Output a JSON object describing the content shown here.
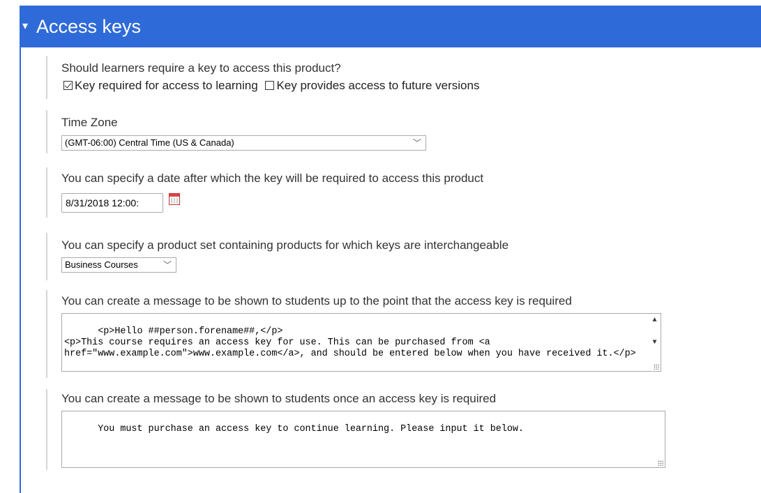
{
  "header": {
    "caret": "▾",
    "title": "Access keys"
  },
  "sections": {
    "require_key": {
      "label": "Should learners require a key to access this product?",
      "options": [
        {
          "label": "Key required for access to learning",
          "checked": true
        },
        {
          "label": "Key provides access to future versions",
          "checked": false
        }
      ]
    },
    "timezone": {
      "label": "Time Zone",
      "selected": "(GMT-06:00) Central Time (US & Canada)"
    },
    "date": {
      "label": "You can specify a date after which the key will be required to access this product",
      "value": "8/31/2018 12:00:"
    },
    "product_set": {
      "label": "You can specify a product set containing products for which keys are interchangeable",
      "selected": "Business Courses"
    },
    "pre_message": {
      "label": "You can create a message to be shown to students up to the point that the access key is required",
      "value": "<p>Hello ##person.forename##,</p>\n<p>This course requires an access key for use. This can be purchased from <a href=\"www.example.com\">www.example.com</a>, and should be entered below when you have received it.</p>"
    },
    "post_message": {
      "label": "You can create a message to be shown to students once an access key is required",
      "value": "You must purchase an access key to continue learning. Please input it below."
    }
  },
  "icons": {
    "checkbox": "checkbox-icon",
    "calendar": "calendar-icon",
    "dropdown": "chevron-down-icon"
  },
  "colors": {
    "header_bg": "#2f6bd8",
    "header_text": "#ffffff"
  }
}
